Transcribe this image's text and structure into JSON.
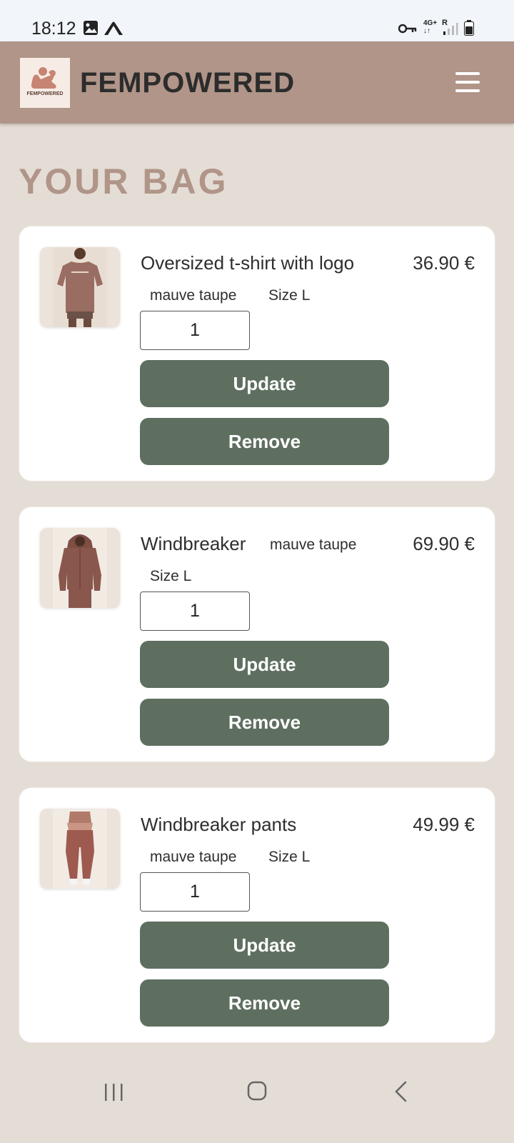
{
  "status_bar": {
    "time": "18:12",
    "network": "4G+",
    "roaming": "R",
    "icons": [
      "image-icon",
      "mountain-icon",
      "key-icon",
      "signal-icon",
      "battery-icon"
    ]
  },
  "header": {
    "logo_text": "FEMPOWERED",
    "brand": "FEMPOWERED",
    "menu_icon": "hamburger-menu-icon"
  },
  "page_title": "YOUR BAG",
  "items": [
    {
      "name": "Oversized t-shirt with logo",
      "price": "36.90 €",
      "color": "mauve taupe",
      "size": "Size L",
      "quantity": "1",
      "update_label": "Update",
      "remove_label": "Remove"
    },
    {
      "name": "Windbreaker",
      "price": "69.90 €",
      "color": "mauve taupe",
      "size": "Size L",
      "quantity": "1",
      "update_label": "Update",
      "remove_label": "Remove"
    },
    {
      "name": "Windbreaker pants",
      "price": "49.99 €",
      "color": "mauve taupe",
      "size": "Size L",
      "quantity": "1",
      "update_label": "Update",
      "remove_label": "Remove"
    }
  ],
  "colors": {
    "header_bg": "#b09588",
    "page_bg": "#e4ddd6",
    "button_bg": "#5e6f60",
    "title_color": "#b09588"
  }
}
